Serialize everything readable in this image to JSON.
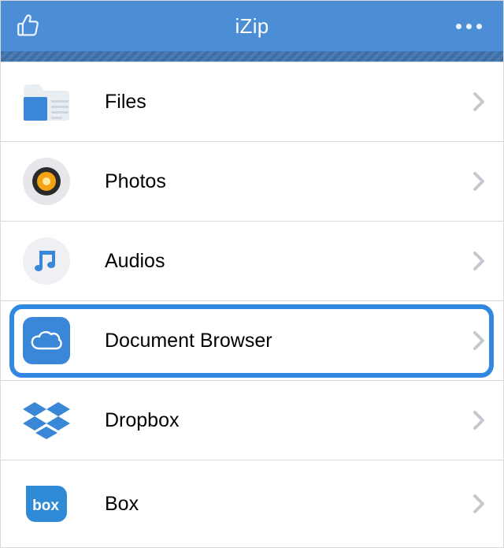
{
  "header": {
    "title": "iZip"
  },
  "menu": {
    "items": [
      {
        "label": "Files",
        "icon": "files-icon",
        "highlighted": false
      },
      {
        "label": "Photos",
        "icon": "photos-icon",
        "highlighted": false
      },
      {
        "label": "Audios",
        "icon": "audios-icon",
        "highlighted": false
      },
      {
        "label": "Document Browser",
        "icon": "cloud-icon",
        "highlighted": true
      },
      {
        "label": "Dropbox",
        "icon": "dropbox-icon",
        "highlighted": false
      },
      {
        "label": "Box",
        "icon": "box-icon",
        "highlighted": false
      }
    ]
  },
  "colors": {
    "header": "#4b8ed6",
    "highlight": "#3088e0",
    "chevron": "#c5c9cf"
  }
}
